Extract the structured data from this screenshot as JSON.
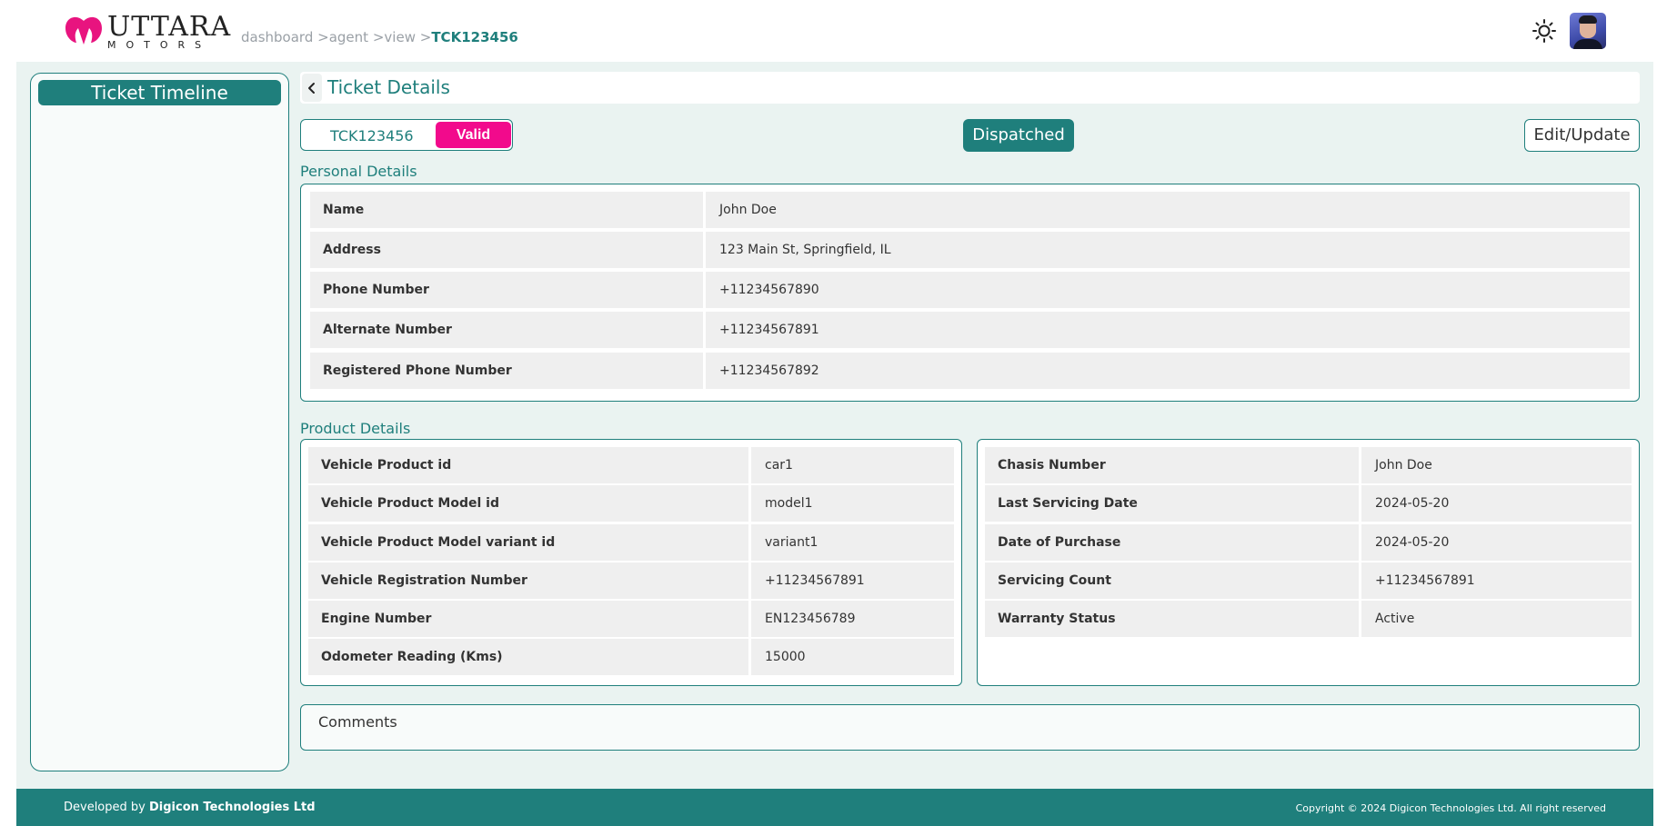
{
  "header": {
    "logo_main": "UTTARA",
    "logo_sub": "MOTORS",
    "breadcrumb": [
      "dashboard",
      "agent",
      "view"
    ],
    "breadcrumb_current": "TCK123456",
    "theme_icon": "sun-icon",
    "avatar": "user-avatar"
  },
  "sidebar": {
    "title": "Ticket Timeline"
  },
  "main": {
    "title": "Ticket Details",
    "ticket_id": "TCK123456",
    "validity": "Valid",
    "status": "Dispatched",
    "edit_label": "Edit/Update"
  },
  "personal": {
    "label": "Personal Details",
    "rows": [
      {
        "key": "Name",
        "value": "John Doe"
      },
      {
        "key": "Address",
        "value": "123 Main St, Springfield, IL"
      },
      {
        "key": "Phone Number",
        "value": "+11234567890"
      },
      {
        "key": "Alternate Number",
        "value": "+11234567891"
      },
      {
        "key": "Registered Phone Number",
        "value": "+11234567892"
      }
    ]
  },
  "product": {
    "label": "Product Details",
    "left": [
      {
        "key": "Vehicle Product id",
        "value": "car1"
      },
      {
        "key": "Vehicle Product Model id",
        "value": "model1"
      },
      {
        "key": "Vehicle Product Model variant id",
        "value": "variant1"
      },
      {
        "key": "Vehicle Registration Number",
        "value": "+11234567891"
      },
      {
        "key": "Engine Number",
        "value": "EN123456789"
      },
      {
        "key": "Odometer Reading (Kms)",
        "value": "15000"
      }
    ],
    "right": [
      {
        "key": "Chasis Number",
        "value": "John Doe"
      },
      {
        "key": "Last Servicing Date",
        "value": "2024-05-20"
      },
      {
        "key": "Date of Purchase",
        "value": "2024-05-20"
      },
      {
        "key": "Servicing Count",
        "value": "+11234567891"
      },
      {
        "key": "Warranty Status",
        "value": "Active"
      }
    ]
  },
  "comments": {
    "label": "Comments"
  },
  "footer": {
    "left_prefix": "Developed by",
    "left_company": "Digicon Technologies Ltd",
    "right": "Copyright © 2024 Digicon Technologies Ltd. All right reserved"
  },
  "colors": {
    "accent": "#1f7f7c",
    "valid": "#f20a8c",
    "background": "#eaf3f1"
  }
}
